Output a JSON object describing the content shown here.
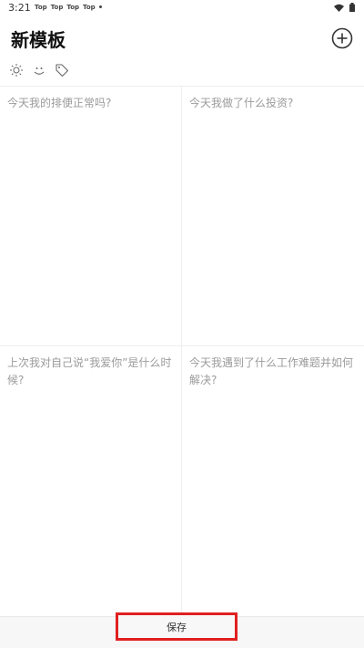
{
  "status_bar": {
    "time": "3:21",
    "notifications": [
      "Top",
      "Top",
      "Top",
      "Top"
    ]
  },
  "header": {
    "title": "新模板",
    "add_icon": "plus-circle-icon"
  },
  "toolbar": {
    "icons": [
      "sun-icon",
      "mood-face-icon",
      "tag-icon"
    ]
  },
  "prompts": [
    "今天我的排便正常吗?",
    "今天我做了什么投资?",
    "上次我对自己说“我爱你”是什么时候?",
    "今天我遇到了什么工作难题并如何解决?"
  ],
  "footer": {
    "save_label": "保存",
    "highlight_color": "#e02020"
  }
}
